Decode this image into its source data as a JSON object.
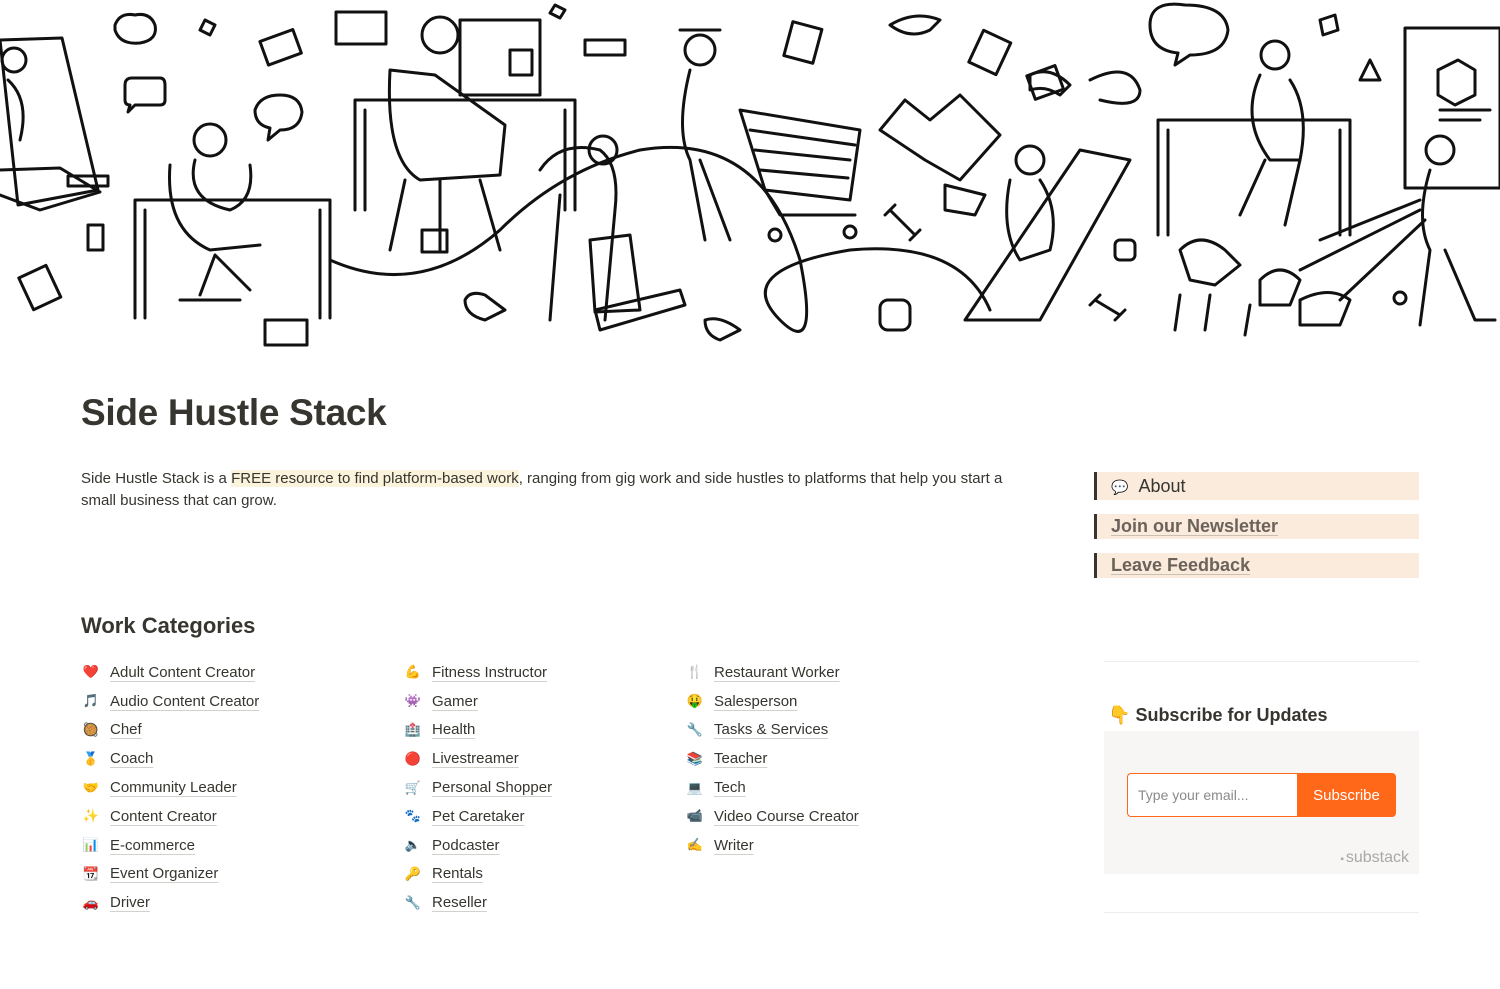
{
  "page": {
    "title": "Side Hustle Stack",
    "intro_before": "Side Hustle Stack is a ",
    "intro_highlight": "FREE resource to find platform-based work",
    "intro_after": ", ranging from gig work and side hustles to platforms that help you start a small business that can grow."
  },
  "sidebar": {
    "about": {
      "icon": "speech-bubble-icon",
      "glyph": "💬",
      "label": "About"
    },
    "newsletter": "Join our Newsletter",
    "feedback": "Leave Feedback"
  },
  "categories": {
    "heading": "Work Categories",
    "columns": [
      [
        {
          "icon": "heart-icon",
          "glyph": "❤️",
          "label": "Adult Content Creator"
        },
        {
          "icon": "music-note-icon",
          "glyph": "🎵",
          "label": "Audio Content Creator"
        },
        {
          "icon": "pan-icon",
          "glyph": "🥘",
          "label": "Chef"
        },
        {
          "icon": "medal-icon",
          "glyph": "🥇",
          "label": "Coach"
        },
        {
          "icon": "handshake-icon",
          "glyph": "🤝",
          "label": "Community Leader"
        },
        {
          "icon": "sparkles-icon",
          "glyph": "✨",
          "label": "Content Creator"
        },
        {
          "icon": "bar-chart-icon",
          "glyph": "📊",
          "label": "E-commerce"
        },
        {
          "icon": "calendar-icon",
          "glyph": "📆",
          "label": "Event Organizer"
        },
        {
          "icon": "car-icon",
          "glyph": "🚗",
          "label": "Driver"
        }
      ],
      [
        {
          "icon": "flexed-bicep-icon",
          "glyph": "💪",
          "label": "Fitness Instructor"
        },
        {
          "icon": "game-controller-icon",
          "glyph": "👾",
          "label": "Gamer"
        },
        {
          "icon": "hospital-icon",
          "glyph": "🏥",
          "label": "Health"
        },
        {
          "icon": "red-circle-icon",
          "glyph": "🔴",
          "label": "Livestreamer"
        },
        {
          "icon": "shopping-cart-icon",
          "glyph": "🛒",
          "label": "Personal Shopper"
        },
        {
          "icon": "paw-prints-icon",
          "glyph": "🐾",
          "label": "Pet Caretaker"
        },
        {
          "icon": "speaker-icon",
          "glyph": "🔈",
          "label": "Podcaster"
        },
        {
          "icon": "key-icon",
          "glyph": "🔑",
          "label": "Rentals"
        },
        {
          "icon": "wrench-icon",
          "glyph": "🔧",
          "label": "Reseller"
        }
      ],
      [
        {
          "icon": "fork-knife-icon",
          "glyph": "🍴",
          "label": "Restaurant Worker"
        },
        {
          "icon": "money-mouth-face-icon",
          "glyph": "🤑",
          "label": "Salesperson"
        },
        {
          "icon": "wrench-icon",
          "glyph": "🔧",
          "label": "Tasks & Services"
        },
        {
          "icon": "books-icon",
          "glyph": "📚",
          "label": "Teacher"
        },
        {
          "icon": "computer-icon",
          "glyph": "💻",
          "label": "Tech"
        },
        {
          "icon": "video-icon",
          "glyph": "📹",
          "label": "Video Course Creator"
        },
        {
          "icon": "writing-hand-icon",
          "glyph": "✍️",
          "label": "Writer"
        }
      ]
    ]
  },
  "subscribe": {
    "icon": "pointing-down-icon",
    "glyph": "👇",
    "title": "Subscribe for Updates",
    "email_placeholder": "Type your email...",
    "button_label": "Subscribe",
    "brand": "substack",
    "brand_color": "#ff6719"
  },
  "colors": {
    "callout_bg": "#faebdd",
    "highlight_bg": "#fbf3db",
    "text": "#37352f"
  }
}
